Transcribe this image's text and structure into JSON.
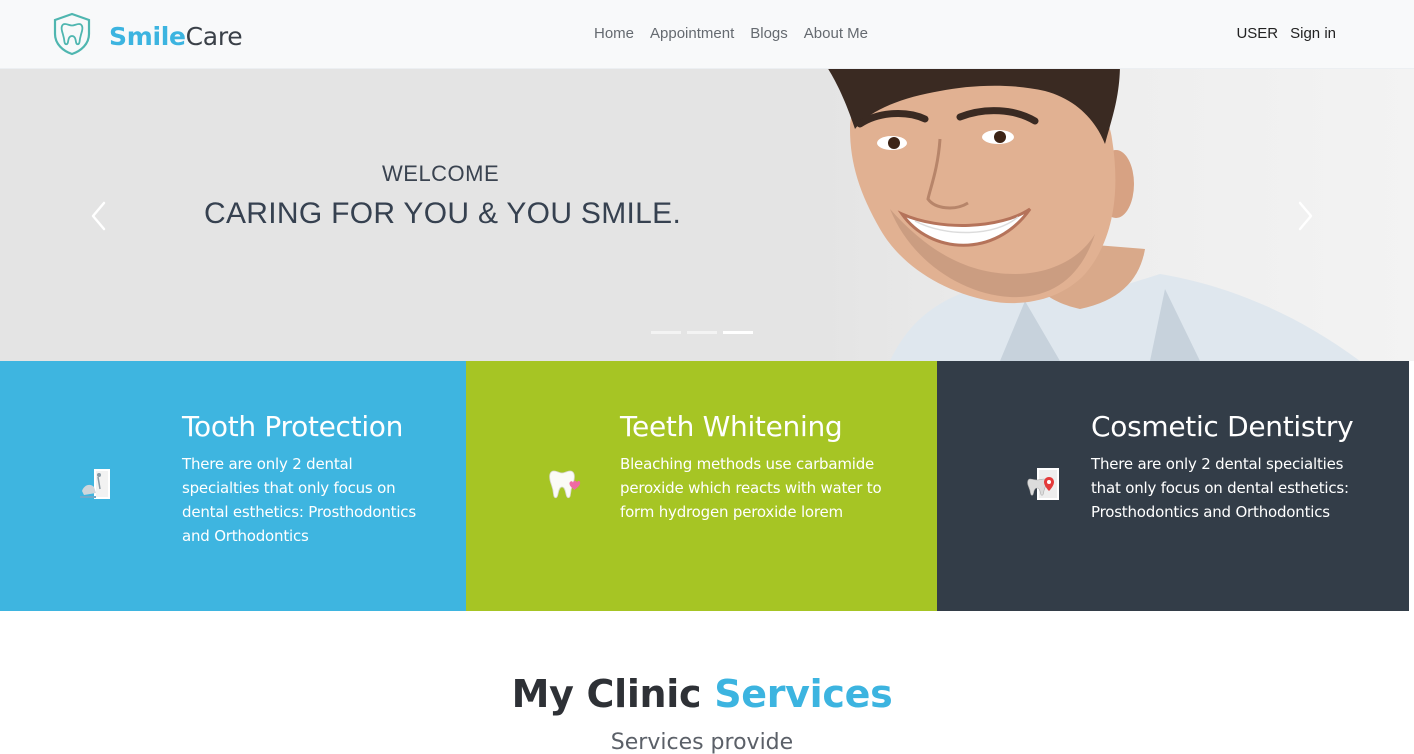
{
  "brand": {
    "smile": "Smile",
    "care": "Care",
    "logo_icon": "tooth-shield-icon"
  },
  "nav": {
    "links": [
      "Home",
      "Appointment",
      "Blogs",
      "About Me"
    ],
    "user": "USER",
    "signin": "Sign in"
  },
  "hero": {
    "welcome": "WELCOME",
    "caption": "CARING FOR YOU & YOU SMILE.",
    "prev_icon": "chevron-left-icon",
    "next_icon": "chevron-right-icon",
    "slides_total": 3,
    "active_slide": 3,
    "image": "smiling-man-photo"
  },
  "features": [
    {
      "title": "Tooth Protection",
      "text": "There are only 2 dental specialties that only focus on dental esthetics: Prosthodontics and Orthodontics",
      "icon": "dental-tools-icon",
      "color": "#3eb5e0"
    },
    {
      "title": "Teeth Whitening",
      "text": "Bleaching methods use carbamide peroxide which reacts with water to form hydrogen peroxide lorem",
      "icon": "tooth-heart-icon",
      "color": "#a6c524"
    },
    {
      "title": "Cosmetic Dentistry",
      "text": "There are only 2 dental specialties that only focus on dental esthetics: Prosthodontics and Orthodontics",
      "icon": "tooth-location-icon",
      "color": "#333d48"
    }
  ],
  "services": {
    "title_main": "My Clinic",
    "title_accent": "Services",
    "subtitle": "Services provide"
  },
  "colors": {
    "accent": "#3cb4e0",
    "green": "#a6c524",
    "dark": "#333d48"
  }
}
